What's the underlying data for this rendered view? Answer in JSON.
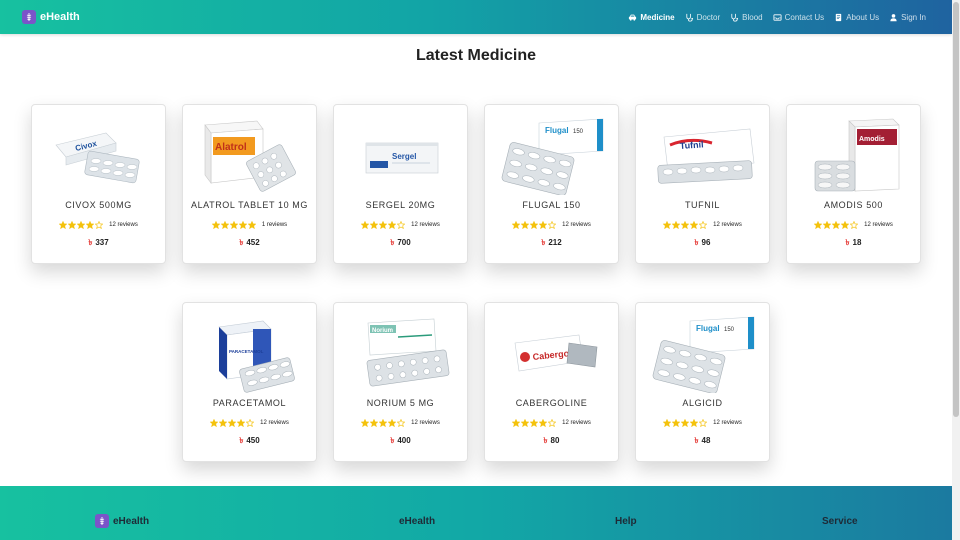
{
  "navbar": {
    "brand": "eHealth",
    "links": [
      {
        "label": "Medicine",
        "icon": "car-icon",
        "active": true
      },
      {
        "label": "Doctor",
        "icon": "stethoscope-icon",
        "active": false
      },
      {
        "label": "Blood",
        "icon": "stethoscope-icon",
        "active": false
      },
      {
        "label": "Contact Us",
        "icon": "inbox-icon",
        "active": false
      },
      {
        "label": "About Us",
        "icon": "document-icon",
        "active": false
      },
      {
        "label": "Sign In",
        "icon": "user-icon",
        "active": false
      }
    ]
  },
  "page": {
    "title": "Latest Medicine"
  },
  "currency_symbol": "৳",
  "colors": {
    "accent_start": "#17c1a0",
    "accent_end": "#1f63a0",
    "star": "#f4c20d",
    "price_symbol": "#e53935",
    "logo": "#7b54c9"
  },
  "medicines": [
    {
      "name": "CIVOX 500MG",
      "rating": 4,
      "reviews": "12 reviews",
      "price": "337"
    },
    {
      "name": "ALATROL TABLET 10 MG",
      "rating": 5,
      "reviews": "1 reviews",
      "price": "452"
    },
    {
      "name": "SERGEL 20MG",
      "rating": 4,
      "reviews": "12 reviews",
      "price": "700"
    },
    {
      "name": "FLUGAL 150",
      "rating": 4,
      "reviews": "12 reviews",
      "price": "212"
    },
    {
      "name": "TUFNIL",
      "rating": 4,
      "reviews": "12 reviews",
      "price": "96"
    },
    {
      "name": "AMODIS 500",
      "rating": 4,
      "reviews": "12 reviews",
      "price": "18"
    },
    {
      "name": "PARACETAMOL",
      "rating": 4,
      "reviews": "12 reviews",
      "price": "450"
    },
    {
      "name": "NORIUM 5 MG",
      "rating": 4,
      "reviews": "12 reviews",
      "price": "400"
    },
    {
      "name": "CABERGOLINE",
      "rating": 4,
      "reviews": "12 reviews",
      "price": "80"
    },
    {
      "name": "ALGICID",
      "rating": 4,
      "reviews": "12 reviews",
      "price": "48"
    }
  ],
  "footer": {
    "brand": "eHealth",
    "col2": "eHealth",
    "col3": "Help",
    "col4": "Service"
  }
}
